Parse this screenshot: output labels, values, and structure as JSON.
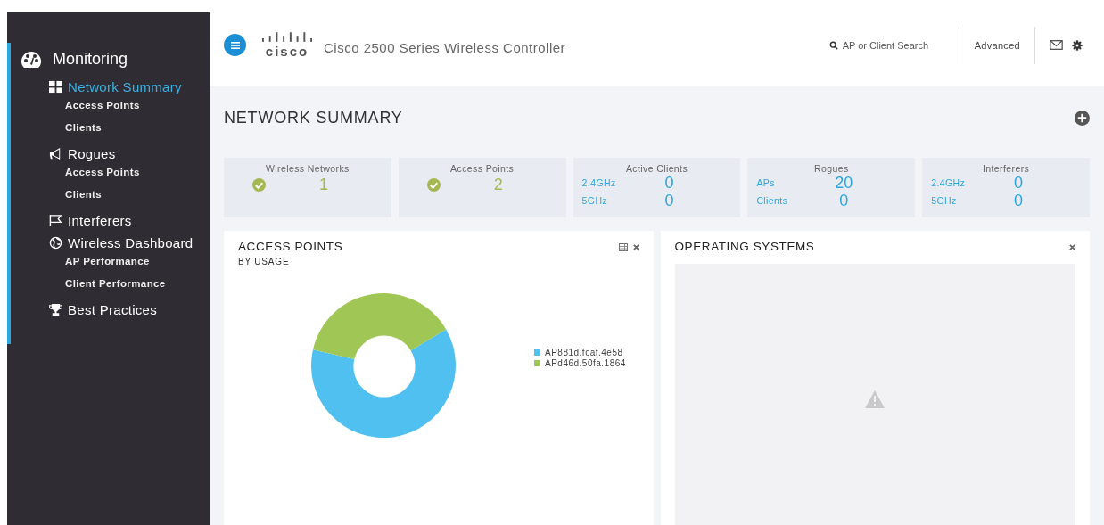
{
  "sidebar": {
    "section": "Monitoring",
    "items": [
      {
        "label": "Network Summary",
        "selected": true,
        "children": [
          {
            "label": "Access Points",
            "selected": false
          },
          {
            "label": "Clients",
            "selected": false
          }
        ]
      },
      {
        "label": "Rogues",
        "selected": false,
        "children": [
          {
            "label": "Access Points",
            "selected": false
          },
          {
            "label": "Clients",
            "selected": false
          }
        ]
      },
      {
        "label": "Interferers",
        "selected": false
      },
      {
        "label": "Wireless Dashboard",
        "selected": false,
        "children": [
          {
            "label": "AP Performance",
            "selected": false
          },
          {
            "label": "Client Performance",
            "selected": false
          }
        ]
      },
      {
        "label": "Best Practices",
        "selected": false
      }
    ]
  },
  "header": {
    "logo": "cisco",
    "title": "Cisco 2500 Series Wireless Controller",
    "search": {
      "placeholder": "AP or Client Search"
    },
    "advanced": "Advanced"
  },
  "page_title": "NETWORK SUMMARY",
  "tiles": [
    {
      "title": "Wireless Networks",
      "kind": "single",
      "value": "1"
    },
    {
      "title": "Access Points",
      "kind": "single",
      "value": "2"
    },
    {
      "title": "Active Clients",
      "kind": "pairs",
      "rows": [
        {
          "label": "2.4GHz",
          "value": "0"
        },
        {
          "label": "5GHz",
          "value": "0"
        }
      ]
    },
    {
      "title": "Rogues",
      "kind": "pairs",
      "rows": [
        {
          "label": "APs",
          "value": "20"
        },
        {
          "label": "Clients",
          "value": "0"
        }
      ]
    },
    {
      "title": "Interferers",
      "kind": "pairs",
      "rows": [
        {
          "label": "2.4GHz",
          "value": "0"
        },
        {
          "label": "5GHz",
          "value": "0"
        }
      ]
    }
  ],
  "panels": [
    {
      "title": "ACCESS POINTS",
      "kind": "donut",
      "subtitle": "BY USAGE",
      "legend": [
        {
          "label": "AP881d.fcaf.4e58",
          "color": "#4fc0ef"
        },
        {
          "label": "APd46d.50fa.1864",
          "color": "#a0c655"
        }
      ]
    },
    {
      "title": "OPERATING SYSTEMS",
      "kind": "empty"
    }
  ]
}
